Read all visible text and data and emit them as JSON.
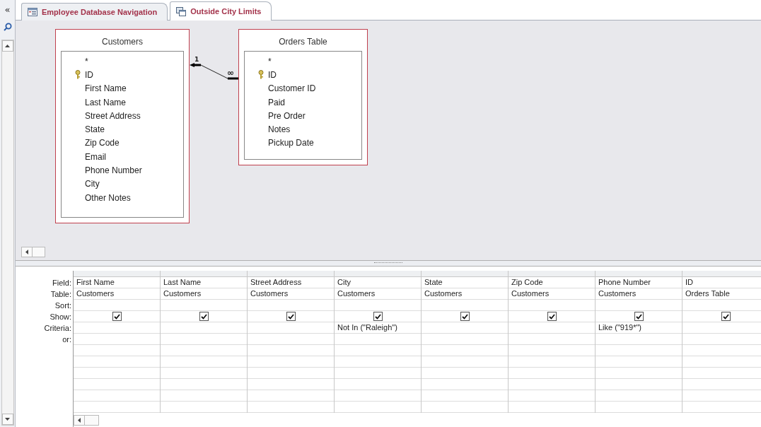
{
  "nav": {
    "collapse": "«"
  },
  "tabs": [
    {
      "label": "Employee Database Navigation",
      "kind": "form",
      "selected": false
    },
    {
      "label": "Outside City Limits",
      "kind": "query",
      "selected": true
    }
  ],
  "tables": [
    {
      "title": "Customers",
      "fields": [
        {
          "name": "*",
          "key": false
        },
        {
          "name": "ID",
          "key": true
        },
        {
          "name": "First Name",
          "key": false
        },
        {
          "name": "Last Name",
          "key": false
        },
        {
          "name": "Street Address",
          "key": false
        },
        {
          "name": "State",
          "key": false
        },
        {
          "name": "Zip Code",
          "key": false
        },
        {
          "name": "Email",
          "key": false
        },
        {
          "name": "Phone Number",
          "key": false
        },
        {
          "name": "City",
          "key": false
        },
        {
          "name": "Other Notes",
          "key": false
        }
      ]
    },
    {
      "title": "Orders Table",
      "fields": [
        {
          "name": "*",
          "key": false
        },
        {
          "name": "ID",
          "key": true
        },
        {
          "name": "Customer ID",
          "key": false
        },
        {
          "name": "Paid",
          "key": false
        },
        {
          "name": "Pre Order",
          "key": false
        },
        {
          "name": "Notes",
          "key": false
        },
        {
          "name": "Pickup Date",
          "key": false
        }
      ]
    }
  ],
  "relationship": {
    "one_label": "1",
    "many_label": "∞"
  },
  "grid": {
    "row_labels": [
      "Field:",
      "Table:",
      "Sort:",
      "Show:",
      "Criteria:",
      "or:"
    ],
    "columns": [
      {
        "field": "First Name",
        "table": "Customers",
        "show": true
      },
      {
        "field": "Last Name",
        "table": "Customers",
        "show": true
      },
      {
        "field": "Street Address",
        "table": "Customers",
        "show": true
      },
      {
        "field": "City",
        "table": "Customers",
        "show": true,
        "criteria": "Not In (\"Raleigh\")"
      },
      {
        "field": "State",
        "table": "Customers",
        "show": true
      },
      {
        "field": "Zip Code",
        "table": "Customers",
        "show": true
      },
      {
        "field": "Phone Number",
        "table": "Customers",
        "show": true,
        "criteria": "Like (\"919*\")"
      },
      {
        "field": "ID",
        "table": "Orders Table",
        "show": true
      }
    ]
  }
}
